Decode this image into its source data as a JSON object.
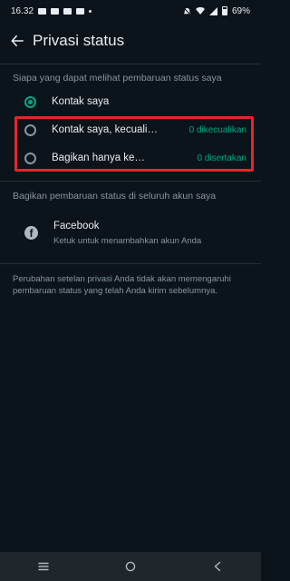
{
  "status_bar": {
    "time": "16.32",
    "battery": "69%"
  },
  "header": {
    "title": "Privasi status"
  },
  "privacy": {
    "section_label": "Siapa yang dapat melihat pembaruan status saya",
    "options": [
      {
        "label": "Kontak saya",
        "count": "",
        "selected": true
      },
      {
        "label": "Kontak saya, kecuali…",
        "count": "0 dikecualikan",
        "selected": false
      },
      {
        "label": "Bagikan hanya ke…",
        "count": "0 disertakan",
        "selected": false
      }
    ]
  },
  "share": {
    "section_label": "Bagikan pembaruan status di seluruh akun saya",
    "facebook_title": "Facebook",
    "facebook_subtitle": "Ketuk untuk menambahkan akun Anda"
  },
  "footnote": "Perubahan setelan privasi Anda tidak akan memengaruhi pembaruan status yang telah Anda kirim sebelumnya.",
  "colors": {
    "background": "#0b141a",
    "accent": "#00a884",
    "highlight": "#e3262c"
  },
  "icons": {
    "back": "arrow-left-icon",
    "facebook": "facebook-icon",
    "nav_recents": "menu-icon",
    "nav_home": "circle-icon",
    "nav_back": "chevron-left-icon"
  }
}
